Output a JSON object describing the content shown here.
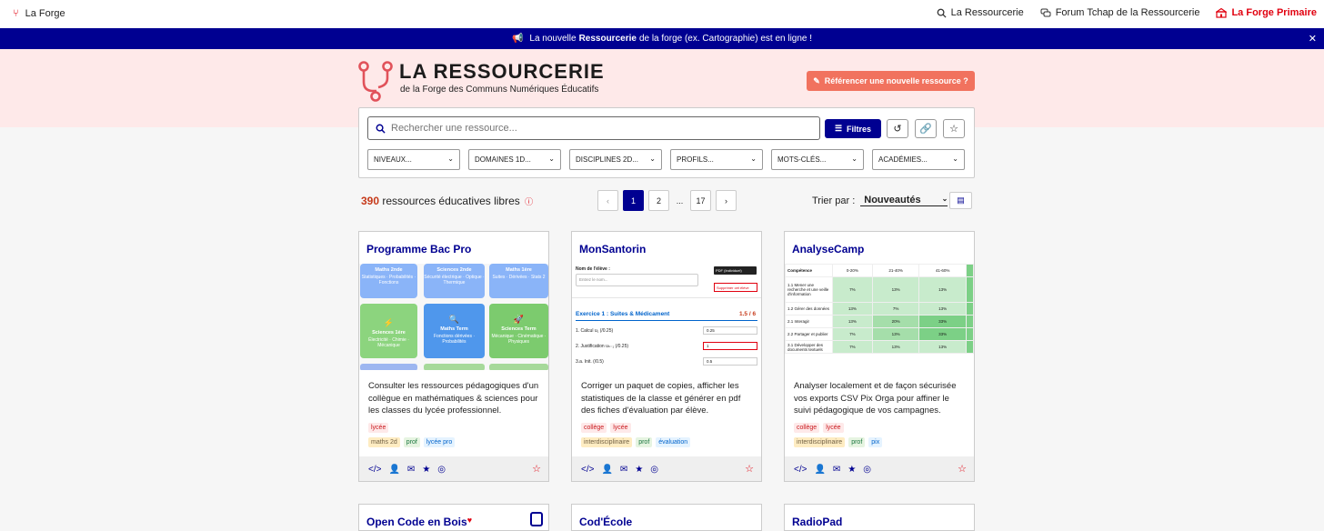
{
  "topbar": {
    "brand": "La Forge",
    "nav": [
      {
        "label": "La Ressourcerie",
        "icon": "search-icon"
      },
      {
        "label": "Forum Tchap de la Ressourcerie",
        "icon": "chat-icon"
      },
      {
        "label": "La Forge Primaire",
        "icon": "school-icon"
      }
    ]
  },
  "banner": {
    "before": "La nouvelle",
    "bold": "Ressourcerie",
    "after": "de la forge (ex. Cartographie) est en ligne !"
  },
  "hero": {
    "title": "LA RESSOURCERIE",
    "subtitle": "de la Forge des Communs Numériques Éducatifs",
    "cta": "Référencer une nouvelle ressource ?"
  },
  "search": {
    "placeholder": "Rechercher une ressource...",
    "filters_label": "Filtres",
    "dropdowns": [
      "NIVEAUX...",
      "DOMAINES 1D...",
      "DISCIPLINES 2D...",
      "PROFILS...",
      "MOTS-CLÉS...",
      "ACADÉMIES..."
    ]
  },
  "results": {
    "count": "390",
    "count_label": "ressources éducatives libres",
    "pages": [
      "1",
      "2",
      "...",
      "17"
    ],
    "sort_label": "Trier par :",
    "sort_value": "Nouveautés"
  },
  "cards": [
    {
      "title": "Programme Bac Pro",
      "desc": "Consulter les ressources pédagogiques d'un collègue en mathématiques & sciences pour les classes du lycée professionnel.",
      "tags1": [
        "lycée"
      ],
      "tags2": [
        "maths 2d",
        "prof",
        "lycée pro"
      ],
      "thumb": {
        "tiles": [
          {
            "t": "Maths 2nde",
            "s": "Statistiques · Probabilités · Fonctions"
          },
          {
            "t": "Sciences 2nde",
            "s": "Sécurité électrique · Optique · Thermique"
          },
          {
            "t": "Maths 1ère",
            "s": "Suites · Dérivées · Stats 2"
          },
          {
            "t": "Sciences 1ère",
            "s": "Électricité · Chimie · Mécanique"
          },
          {
            "t": "Maths Term",
            "s": "Fonctions dérivées · Probabilités"
          },
          {
            "t": "Sciences Term",
            "s": "Mécanique · Cinématique · Physiques"
          }
        ]
      }
    },
    {
      "title": "MonSantorin",
      "desc": "Corriger un paquet de copies, afficher les statistiques de la classe et générer en pdf des fiches d'évaluation par élève.",
      "tags1": [
        "collège",
        "lycée"
      ],
      "tags2": [
        "interdisciplinaire",
        "prof",
        "évaluation"
      ],
      "thumb": {
        "name_label": "Nom de l'élève :",
        "name_placeholder": "Entrez le nom...",
        "pdf": "PDF (Individuel)",
        "delete": "Supprimer cet élève",
        "exercise": "Exercice 1 : Suites & Médicament",
        "score": "1.5 / 6",
        "rows": [
          {
            "q": "1. Calcul u₁ (/0.25)",
            "v": "0.25"
          },
          {
            "q": "2. Justification uₙ₋₁ (/0.25)",
            "v": "1"
          },
          {
            "q": "3.a. Init. (/0.5)",
            "v": "0.5"
          }
        ]
      }
    },
    {
      "title": "AnalyseCamp",
      "desc": "Analyser localement et de façon sécurisée vos exports CSV Pix Orga pour affiner le suivi pédagogique de vos campagnes.",
      "tags1": [
        "collège",
        "lycée"
      ],
      "tags2": [
        "interdisciplinaire",
        "prof",
        "pix"
      ],
      "thumb": {
        "headers": [
          "Compétence",
          "0-20%",
          "21-40%",
          "41-60%"
        ],
        "rows": [
          {
            "c": "1.1 Mener une recherche et une veille d'information",
            "v": [
              "7%",
              "13%",
              "13%"
            ]
          },
          {
            "c": "1.2 Gérer des données",
            "v": [
              "13%",
              "7%",
              "13%"
            ]
          },
          {
            "c": "2.1 Interagir",
            "v": [
              "13%",
              "20%",
              "33%"
            ]
          },
          {
            "c": "2.2 Partager et publier",
            "v": [
              "7%",
              "13%",
              "33%"
            ]
          },
          {
            "c": "3.1 Développer des documents textuels",
            "v": [
              "7%",
              "13%",
              "13%"
            ]
          }
        ]
      }
    }
  ],
  "next_cards": [
    "Open Code en Bois",
    "Cod'École",
    "RadioPad"
  ],
  "colors": {
    "primary": "#000091",
    "accent": "#e1000f",
    "hero_bg": "#fee9e9",
    "cta": "#f1725e"
  }
}
